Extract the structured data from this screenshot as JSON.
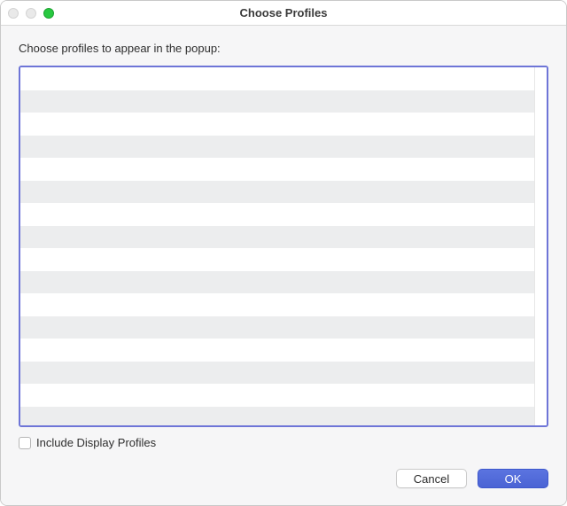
{
  "window": {
    "title": "Choose Profiles"
  },
  "instruction": "Choose profiles to appear in the popup:",
  "profile_list": {
    "rows": [
      "",
      "",
      "",
      "",
      "",
      "",
      "",
      "",
      "",
      "",
      "",
      "",
      "",
      "",
      "",
      ""
    ]
  },
  "include_display": {
    "label": "Include Display Profiles",
    "checked": false
  },
  "buttons": {
    "cancel": "Cancel",
    "ok": "OK"
  }
}
